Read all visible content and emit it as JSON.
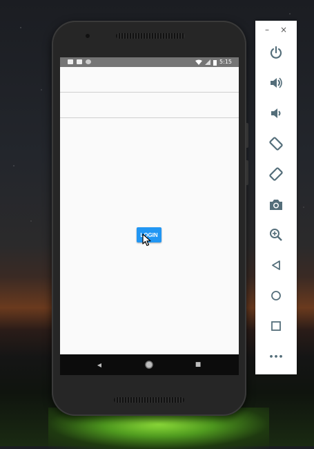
{
  "status_bar": {
    "time": "5:15"
  },
  "form": {
    "username_value": "",
    "password_value": "",
    "login_label": "LOGIN"
  },
  "nav_bar": {
    "back_glyph": "◀",
    "home_glyph": "●",
    "recents_glyph": "■"
  },
  "emulator_toolbar": {
    "minimize_glyph": "–",
    "close_glyph": "×",
    "more_glyph": "•••",
    "buttons": [
      "power-icon",
      "volume-up-icon",
      "volume-down-icon",
      "rotate-left-icon",
      "rotate-right-icon",
      "camera-icon",
      "zoom-icon",
      "back-icon",
      "home-icon",
      "overview-icon",
      "more-icon"
    ]
  },
  "colors": {
    "accent": "#2196f3",
    "toolbar_icon": "#546e7a",
    "status_bar": "#757575"
  }
}
